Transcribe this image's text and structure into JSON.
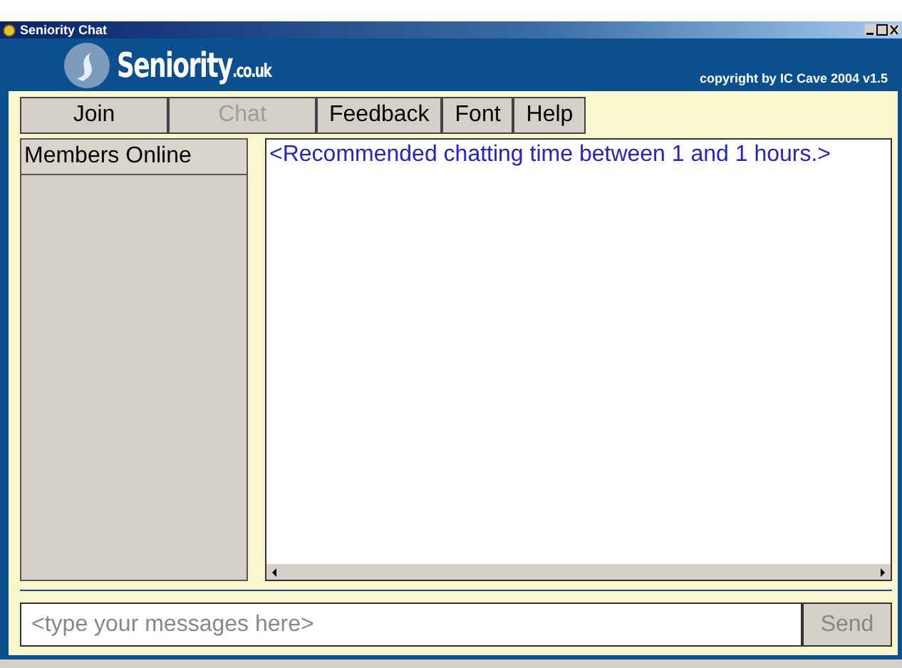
{
  "window": {
    "title": "Seniority Chat"
  },
  "header": {
    "logo_main": "Seniority",
    "logo_suffix": ".co.uk",
    "copyright": "copyright by IC Cave 2004 v1.5"
  },
  "tabs": [
    {
      "label": "Join",
      "disabled": false
    },
    {
      "label": "Chat",
      "disabled": true
    },
    {
      "label": "Feedback",
      "disabled": false
    },
    {
      "label": "Font",
      "disabled": false
    },
    {
      "label": "Help",
      "disabled": false
    }
  ],
  "members": {
    "title": "Members Online"
  },
  "messages": [
    "<Recommended chatting time between 1 and 1 hours.>"
  ],
  "composer": {
    "placeholder": "<type your messages here>",
    "send": "Send",
    "send_disabled": true
  }
}
